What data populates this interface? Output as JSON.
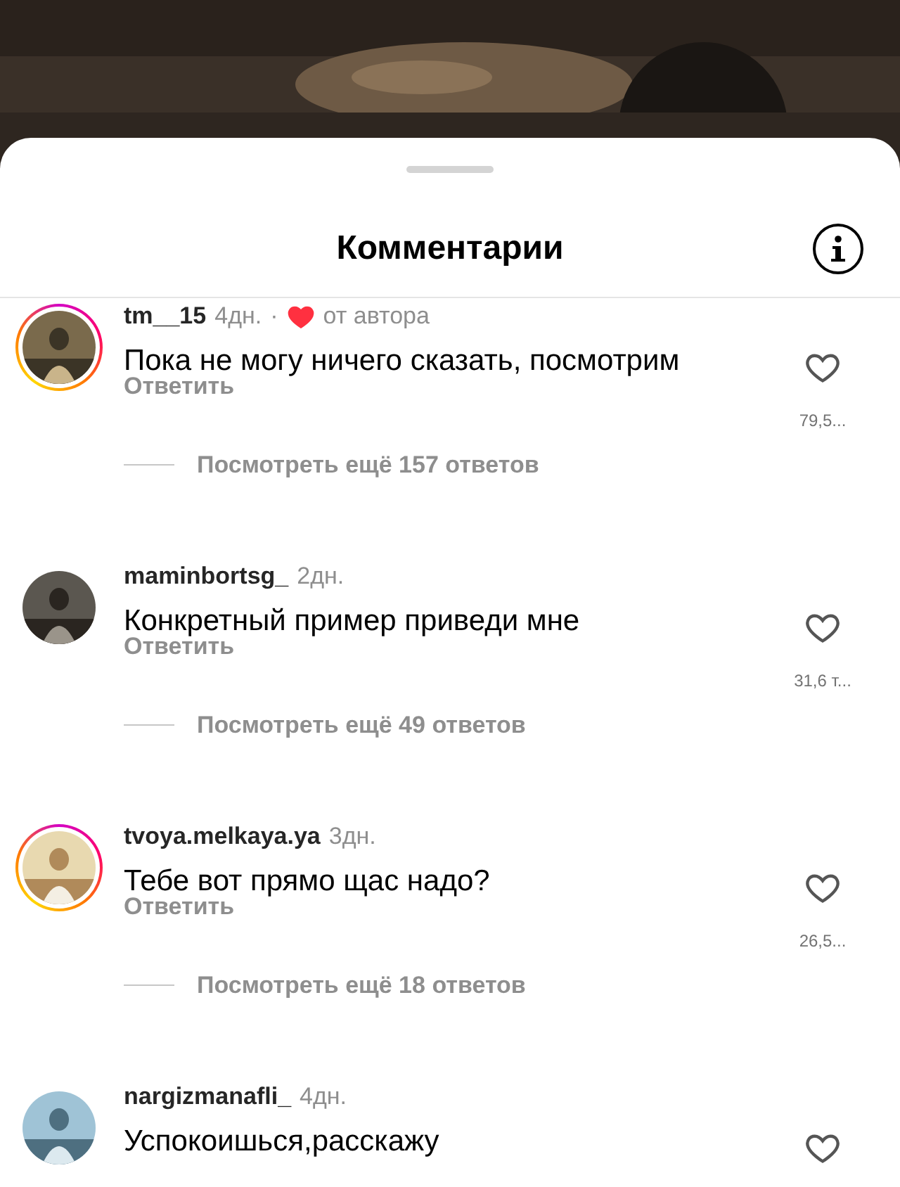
{
  "sheet": {
    "title": "Комментарии"
  },
  "comments": [
    {
      "username": "tm__15",
      "time": "4дн.",
      "story": true,
      "liked_by_author": true,
      "separator": "·",
      "author_label": "от автора",
      "text": "Пока не могу ничего сказать, посмотрим",
      "reply": "Ответить",
      "likes": "79,5...",
      "more_replies": "Посмотреть ещё 157 ответов"
    },
    {
      "username": "maminbortsg_",
      "time": "2дн.",
      "story": false,
      "liked_by_author": false,
      "text": "Конкретный пример приведи мне",
      "reply": "Ответить",
      "likes": "31,6 т...",
      "more_replies": "Посмотреть ещё 49 ответов"
    },
    {
      "username": "tvoya.melkaya.ya",
      "time": "3дн.",
      "story": true,
      "liked_by_author": false,
      "text": "Тебе вот прямо щас надо?",
      "reply": "Ответить",
      "likes": "26,5...",
      "more_replies": "Посмотреть ещё 18 ответов"
    },
    {
      "username": "nargizmanafli_",
      "time": "4дн.",
      "story": false,
      "liked_by_author": false,
      "text": "Успокоишься,расскажу"
    }
  ]
}
